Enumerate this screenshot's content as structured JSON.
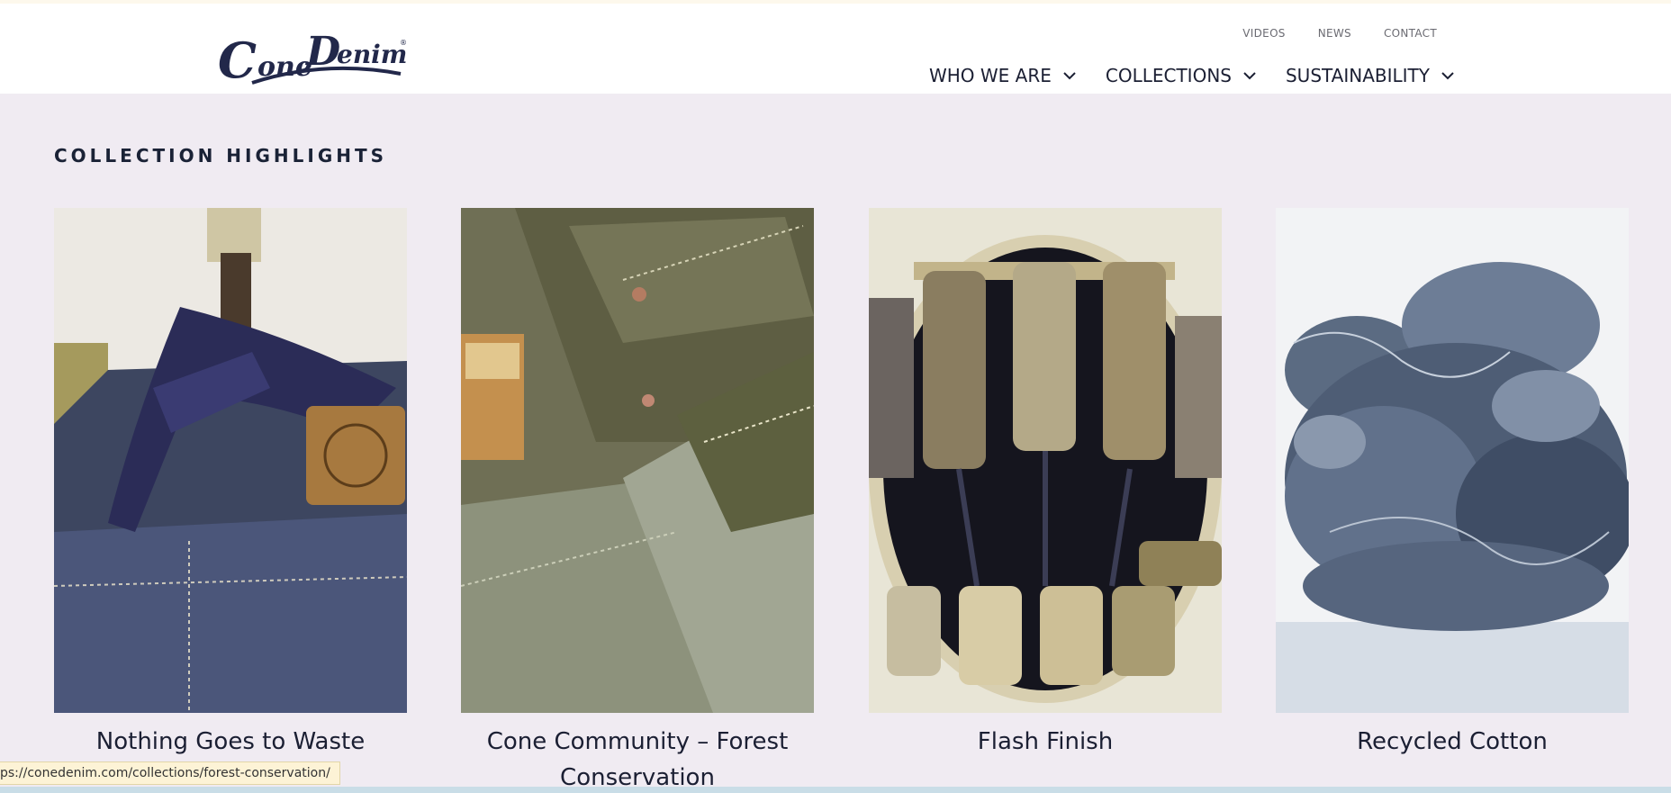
{
  "brand": {
    "name": "Cone Denim",
    "logo_color": "#22284a"
  },
  "utility_nav": [
    "VIDEOS",
    "NEWS",
    "CONTACT"
  ],
  "main_nav": [
    {
      "label": "WHO WE ARE",
      "icon": "chevron-down-icon"
    },
    {
      "label": "COLLECTIONS",
      "icon": "chevron-down-icon"
    },
    {
      "label": "SUSTAINABILITY",
      "icon": "chevron-down-icon"
    }
  ],
  "section": {
    "title": "COLLECTION HIGHLIGHTS"
  },
  "collections": [
    {
      "title": "Nothing Goes to Waste",
      "image": "denim-apron-bandana-photo"
    },
    {
      "title": "Cone Community – Forest Conservation",
      "image": "green-denim-jeans-photo"
    },
    {
      "title": "Flash Finish",
      "image": "finishing-machine-rollers-photo"
    },
    {
      "title": "Recycled Cotton",
      "image": "recycled-cotton-fiber-photo"
    }
  ],
  "status_bar": {
    "url": "ps://conedenim.com/collections/forest-conservation/"
  },
  "colors": {
    "page_bg": "#f0ebf2",
    "header_bg": "#ffffff",
    "text": "#1b1f33"
  }
}
